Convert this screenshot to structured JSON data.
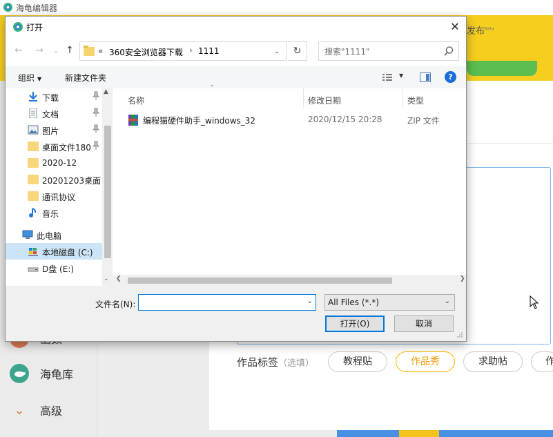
{
  "app": {
    "title": "海龟编辑器",
    "publish_label": "发布",
    "publish_superscript": "Beta",
    "sidebar": [
      {
        "label": "函数",
        "icon": "function-icon"
      },
      {
        "label": "海龟库",
        "icon": "turtle-icon"
      },
      {
        "label": "高级",
        "icon": "chevron-down-icon"
      }
    ],
    "tags_label": "作品标签",
    "tags_hint": "（选填）",
    "tags": [
      "教程贴",
      "作品秀",
      "求助帖",
      "作"
    ],
    "active_tag": "作品秀"
  },
  "dialog": {
    "title": "打开",
    "address": {
      "prefix": "«",
      "crumbs": [
        "360安全浏览器下载",
        "1111"
      ],
      "separator": "›"
    },
    "search": {
      "placeholder": "搜索\"1111\""
    },
    "toolbar": {
      "organize": "组织",
      "new_folder": "新建文件夹",
      "help": "?"
    },
    "nav_items": [
      {
        "label": "下载",
        "icon": "download-icon",
        "pinned": true
      },
      {
        "label": "文档",
        "icon": "document-icon",
        "pinned": true
      },
      {
        "label": "图片",
        "icon": "picture-icon",
        "pinned": true
      },
      {
        "label": "桌面文件180",
        "icon": "folder-icon",
        "pinned": true
      },
      {
        "label": "2020-12",
        "icon": "folder-icon",
        "pinned": false
      },
      {
        "label": "20201203桌面",
        "icon": "folder-icon",
        "pinned": false
      },
      {
        "label": "通讯协议",
        "icon": "folder-icon",
        "pinned": false
      },
      {
        "label": "音乐",
        "icon": "music-icon",
        "pinned": false
      },
      {
        "label": "此电脑",
        "icon": "computer-icon",
        "pinned": false
      },
      {
        "label": "本地磁盘 (C:)",
        "icon": "drive-c-icon",
        "pinned": false,
        "selected": true
      },
      {
        "label": "D盘 (E:)",
        "icon": "drive-icon",
        "pinned": false
      }
    ],
    "columns": {
      "name": "名称",
      "modified": "修改日期",
      "type": "类型"
    },
    "files": [
      {
        "name": "编程猫硬件助手_windows_32",
        "modified": "2020/12/15 20:28",
        "type": "ZIP 文件"
      }
    ],
    "filename_label": "文件名(N):",
    "filename_value": "",
    "filetype_selected": "All Files (*.*)",
    "open_label": "打开(O)",
    "cancel_label": "取消",
    "close_glyph": "✕"
  }
}
